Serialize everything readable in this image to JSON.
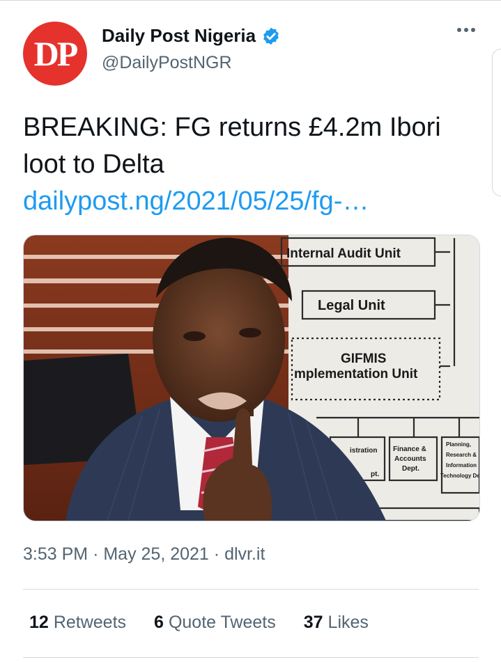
{
  "account": {
    "avatar_text": "DP",
    "name": "Daily Post Nigeria",
    "handle": "@DailyPostNGR",
    "verified": true
  },
  "tweet": {
    "text": "BREAKING: FG returns £4.2m Ibori loot to Delta",
    "link": "dailypost.ng/2021/05/25/fg-…"
  },
  "photo_signs": {
    "internal_audit": "Internal Audit Unit",
    "legal": "Legal Unit",
    "gifmis_line1": "GIFMIS",
    "gifmis_line2": "mplementation Unit",
    "administration": "istration",
    "administration_2": "pt.",
    "finance_1": "Finance &",
    "finance_2": "Accounts",
    "finance_3": "Dept.",
    "planning_1": "Planning,",
    "planning_2": "Research &",
    "planning_3": "Information",
    "planning_4": "Technology Dep"
  },
  "meta": {
    "time": "3:53 PM",
    "date": "May 25, 2021",
    "source": "dlvr.it",
    "separator": "·"
  },
  "stats": {
    "retweets_count": "12",
    "retweets_label": "Retweets",
    "quotes_count": "6",
    "quotes_label": "Quote Tweets",
    "likes_count": "37",
    "likes_label": "Likes"
  },
  "colors": {
    "link": "#1d9bf0",
    "secondary_text": "#536471",
    "avatar_bg": "#e5322d"
  }
}
